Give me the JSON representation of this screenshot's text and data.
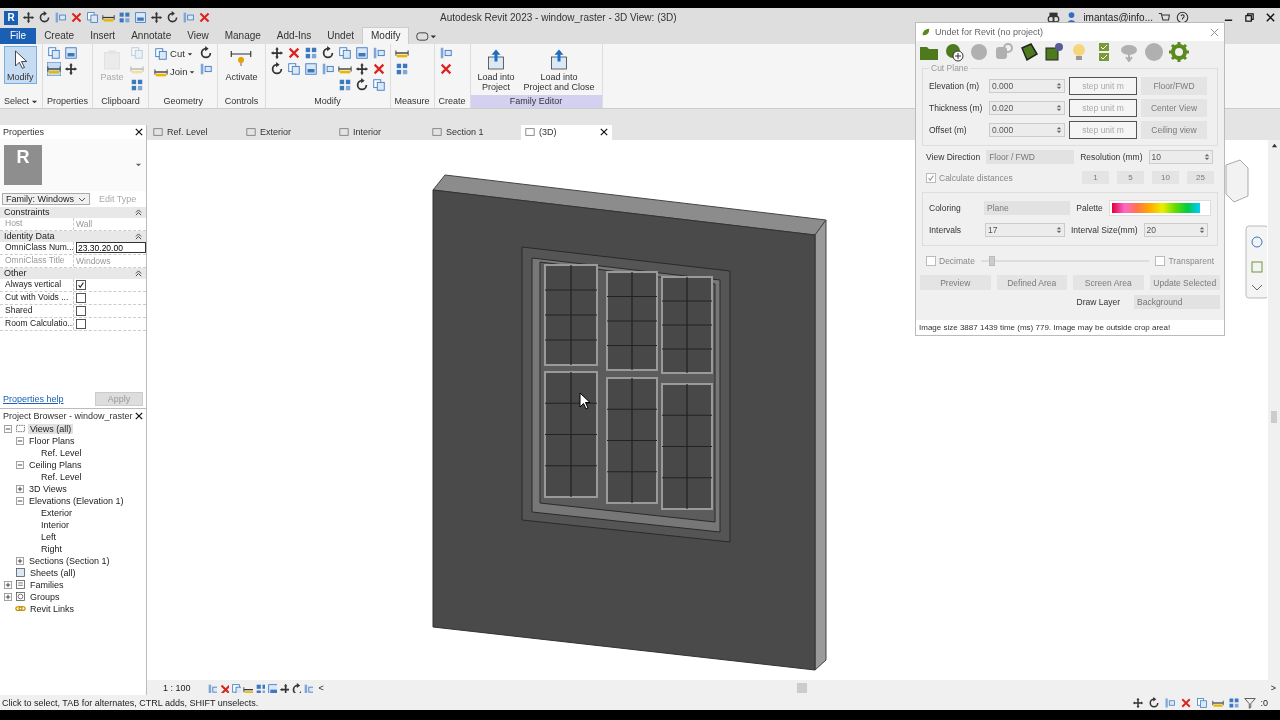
{
  "window": {
    "logo": "R",
    "title": "Autodesk Revit 2023 - window_raster - 3D View: (3D)",
    "user": "imantas@info..."
  },
  "ribbon_tabs": [
    {
      "label": "File",
      "kind": "file",
      "selected": false
    },
    {
      "label": "Create",
      "kind": "tab",
      "selected": false
    },
    {
      "label": "Insert",
      "kind": "tab",
      "selected": false
    },
    {
      "label": "Annotate",
      "kind": "tab",
      "selected": false
    },
    {
      "label": "View",
      "kind": "tab",
      "selected": false
    },
    {
      "label": "Manage",
      "kind": "tab",
      "selected": false
    },
    {
      "label": "Add-Ins",
      "kind": "tab",
      "selected": false
    },
    {
      "label": "Undet",
      "kind": "tab",
      "selected": false
    },
    {
      "label": "Modify",
      "kind": "tab",
      "selected": true
    }
  ],
  "ribbon_panels": [
    {
      "title": "Select",
      "dropdown": true,
      "contextual": false,
      "columns": [
        [
          {
            "kind": "large",
            "label": "Modify",
            "selected": true
          }
        ]
      ]
    },
    {
      "title": "Properties",
      "dropdown": false,
      "contextual": false,
      "columns": [
        [
          {
            "kind": "icon",
            "selected": false
          },
          {
            "kind": "icon",
            "selected": true
          }
        ],
        [
          {
            "kind": "icon",
            "selected": false
          },
          {
            "kind": "icon",
            "selected": false
          }
        ]
      ]
    },
    {
      "title": "Clipboard",
      "dropdown": false,
      "contextual": false,
      "columns": [
        [
          {
            "kind": "large",
            "label": "Paste",
            "disabled": true
          }
        ],
        [
          {
            "kind": "icon",
            "disabled": true
          },
          {
            "kind": "icon",
            "disabled": true
          },
          {
            "kind": "icon",
            "disabled": false
          }
        ]
      ]
    },
    {
      "title": "Geometry",
      "dropdown": false,
      "contextual": false,
      "columns": [
        [
          {
            "kind": "small",
            "label": "Cut"
          },
          {
            "kind": "small",
            "label": "Join"
          }
        ],
        [
          {
            "kind": "icon"
          },
          {
            "kind": "icon"
          }
        ]
      ]
    },
    {
      "title": "Controls",
      "dropdown": false,
      "contextual": false,
      "columns": [
        [
          {
            "kind": "large",
            "label": "Activate"
          }
        ]
      ]
    },
    {
      "title": "Modify",
      "dropdown": false,
      "contextual": false,
      "columns": [
        [
          {
            "kind": "icon"
          },
          {
            "kind": "icon"
          }
        ],
        [
          {
            "kind": "icon"
          },
          {
            "kind": "icon"
          }
        ],
        [
          {
            "kind": "icon"
          },
          {
            "kind": "icon"
          }
        ],
        [
          {
            "kind": "icon"
          },
          {
            "kind": "icon"
          }
        ],
        [
          {
            "kind": "icon"
          },
          {
            "kind": "icon"
          },
          {
            "kind": "icon"
          }
        ],
        [
          {
            "kind": "icon"
          },
          {
            "kind": "icon"
          },
          {
            "kind": "icon"
          }
        ],
        [
          {
            "kind": "icon"
          },
          {
            "kind": "icon"
          },
          {
            "kind": "icon"
          }
        ]
      ]
    },
    {
      "title": "Measure",
      "dropdown": false,
      "contextual": false,
      "columns": [
        [
          {
            "kind": "icon"
          },
          {
            "kind": "icon"
          }
        ]
      ]
    },
    {
      "title": "Create",
      "dropdown": false,
      "contextual": false,
      "columns": [
        [
          {
            "kind": "icon"
          },
          {
            "kind": "icon"
          }
        ]
      ]
    },
    {
      "title": "Family Editor",
      "dropdown": false,
      "contextual": true,
      "columns": [
        [
          {
            "kind": "large",
            "label": "Load into\nProject"
          }
        ],
        [
          {
            "kind": "large",
            "label": "Load into\nProject and Close"
          }
        ]
      ]
    }
  ],
  "properties": {
    "title": "Properties",
    "type_image": "R",
    "type_selector": "Family: Windows",
    "edit_type": "Edit Type",
    "groups": [
      {
        "name": "Constraints",
        "rows": [
          {
            "kind": "text",
            "name": "Host",
            "value": "Wall",
            "disabled": true
          }
        ]
      },
      {
        "name": "Identity Data",
        "rows": [
          {
            "kind": "input",
            "name": "OmniClass Num...",
            "value": "23.30.20.00",
            "disabled": false
          },
          {
            "kind": "text",
            "name": "OmniClass Title",
            "value": "Windows",
            "disabled": true
          }
        ]
      },
      {
        "name": "Other",
        "rows": [
          {
            "kind": "checkbox",
            "name": "Always vertical",
            "checked": true,
            "disabled": false
          },
          {
            "kind": "checkbox",
            "name": "Cut with Voids ...",
            "checked": false,
            "disabled": false
          },
          {
            "kind": "checkbox",
            "name": "Shared",
            "checked": false,
            "disabled": false
          },
          {
            "kind": "checkbox",
            "name": "Room Calculatio...",
            "checked": false,
            "disabled": false
          }
        ]
      }
    ],
    "help_link": "Properties help",
    "apply": {
      "label": "Apply",
      "disabled": true
    }
  },
  "project_browser": {
    "title": "Project Browser - window_raster",
    "tree": [
      {
        "label": "Views (all)",
        "selected": true,
        "expanded": true,
        "children": [
          {
            "label": "Floor Plans",
            "selected": false,
            "expanded": true,
            "children": [
              {
                "label": "Ref. Level",
                "selected": false
              }
            ]
          },
          {
            "label": "Ceiling Plans",
            "selected": false,
            "expanded": true,
            "children": [
              {
                "label": "Ref. Level",
                "selected": false
              }
            ]
          },
          {
            "label": "3D Views",
            "selected": false,
            "expanded": false
          },
          {
            "label": "Elevations (Elevation 1)",
            "selected": false,
            "expanded": true,
            "children": [
              {
                "label": "Exterior",
                "selected": false
              },
              {
                "label": "Interior",
                "selected": false
              },
              {
                "label": "Left",
                "selected": false
              },
              {
                "label": "Right",
                "selected": false
              }
            ]
          },
          {
            "label": "Sections (Section 1)",
            "selected": false,
            "expanded": false
          }
        ]
      },
      {
        "label": "Sheets (all)",
        "selected": false
      },
      {
        "label": "Families",
        "selected": false,
        "expanded": false
      },
      {
        "label": "Groups",
        "selected": false,
        "expanded": false
      },
      {
        "label": "Revit Links",
        "selected": false
      }
    ]
  },
  "view_tabs": [
    {
      "label": "Ref. Level",
      "selected": false
    },
    {
      "label": "Exterior",
      "selected": false
    },
    {
      "label": "Interior",
      "selected": false
    },
    {
      "label": "Section 1",
      "selected": false
    },
    {
      "label": "(3D)",
      "selected": true
    }
  ],
  "view_bar": {
    "scale": "1 : 100",
    "left_arrow": "<",
    "right_arrow": ">"
  },
  "status_bar": {
    "message": "Click to select, TAB for alternates, CTRL adds, SHIFT unselects.",
    "filter_count": ":0"
  },
  "undet": {
    "title": "Undet for Revit (no project)",
    "toolbar": [
      {
        "disabled": false
      },
      {
        "disabled": false
      },
      {
        "disabled": true
      },
      {
        "disabled": true
      },
      {
        "disabled": false
      },
      {
        "disabled": false
      },
      {
        "disabled": false
      },
      {
        "disabled": false
      },
      {
        "disabled": true
      },
      {
        "disabled": true
      },
      {
        "disabled": false
      }
    ],
    "cut_plane": {
      "label": "Cut Plane",
      "rows": [
        {
          "label": "Elevation (m)",
          "value": "0.000",
          "step": "step unit m",
          "action": {
            "label": "Floor/FWD",
            "disabled": true
          }
        },
        {
          "label": "Thickness (m)",
          "value": "0.020",
          "step": "step unit m",
          "action": {
            "label": "Center View",
            "disabled": true
          }
        },
        {
          "label": "Offset (m)",
          "value": "0.000",
          "step": "step unit m",
          "action": {
            "label": "Ceiling view",
            "disabled": true
          }
        }
      ]
    },
    "view_direction": {
      "label": "View Direction",
      "value": "Floor / FWD",
      "disabled": true
    },
    "resolution": {
      "label": "Resolution (mm)",
      "value": "10"
    },
    "preset_buttons": [
      {
        "label": "1",
        "disabled": true
      },
      {
        "label": "5",
        "disabled": true
      },
      {
        "label": "10",
        "disabled": true
      },
      {
        "label": "25",
        "disabled": true
      }
    ],
    "calculate_distances": {
      "label": "Calculate distances",
      "checked": true,
      "disabled": true
    },
    "coloring": {
      "label": "Coloring",
      "value": "Plane",
      "disabled": true
    },
    "palette": {
      "label": "Palette"
    },
    "intervals": {
      "label": "Intervals",
      "value": "17"
    },
    "interval_size": {
      "label": "Interval Size(mm)",
      "value": "20"
    },
    "decimate": {
      "label": "Decimate",
      "checked": false,
      "disabled": true,
      "level": 0.05
    },
    "transparent": {
      "label": "Transparent",
      "checked": false,
      "disabled": true
    },
    "actions": [
      {
        "label": "Preview",
        "disabled": true
      },
      {
        "label": "Defined Area",
        "disabled": true
      },
      {
        "label": "Screen Area",
        "disabled": true
      },
      {
        "label": "Update Selected",
        "disabled": true
      }
    ],
    "draw_layer": {
      "label": "Draw Layer",
      "value": "Background",
      "disabled": true
    },
    "message": "Image size 3887 1439 time (ms) 779. Image may be outside crop area!"
  }
}
